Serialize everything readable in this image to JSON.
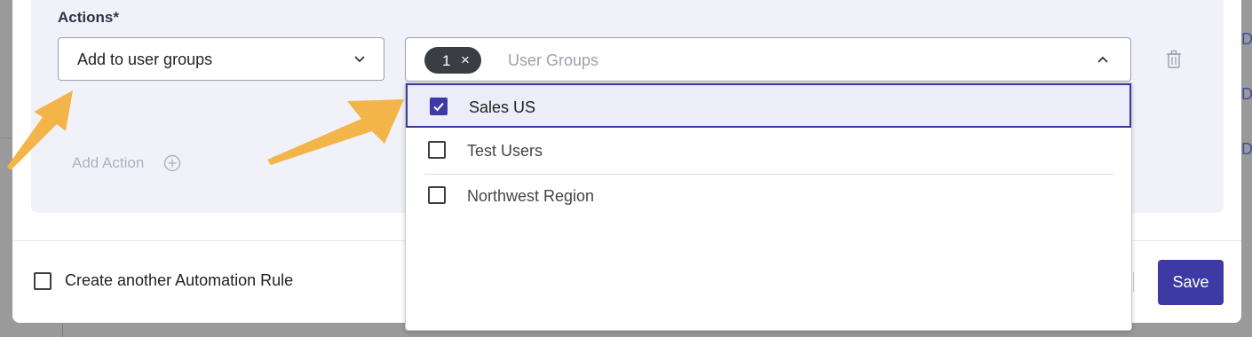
{
  "actions": {
    "label": "Actions*",
    "action_select": {
      "value": "Add to user groups"
    },
    "user_groups": {
      "chip_count": "1",
      "chip_remove": "×",
      "placeholder": "User Groups",
      "options": [
        {
          "label": "Sales US",
          "checked": true
        },
        {
          "label": "Test Users",
          "checked": false
        },
        {
          "label": "Northwest Region",
          "checked": false
        }
      ]
    },
    "add_action_label": "Add Action"
  },
  "footer": {
    "create_another_label": "Create another Automation Rule",
    "create_another_checked": false,
    "save_label": "Save"
  },
  "colors": {
    "primary": "#3d3ba3",
    "panel_bg": "#f1f2f9",
    "annotation_arrow": "#f3b54a"
  },
  "icons": [
    "chevron-down-icon",
    "chevron-up-icon",
    "close-icon",
    "trash-icon",
    "plus-circle-icon",
    "checkmark-icon",
    "annotation-arrow"
  ]
}
